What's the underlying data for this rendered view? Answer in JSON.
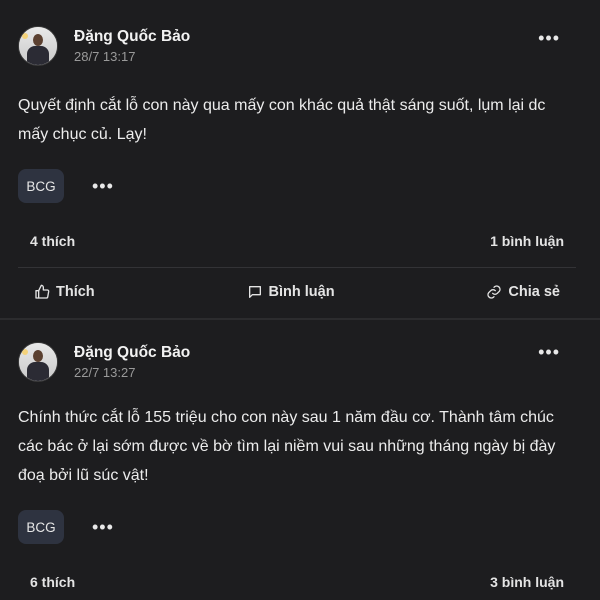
{
  "posts": [
    {
      "author": "Đặng Quốc Bảo",
      "time": "28/7 13:17",
      "content": "Quyết định cắt lỗ con này qua mấy con khác quả thật sáng suốt, lụm lại dc mấy chục củ. Lạy!",
      "tag": "BCG",
      "likes": "4 thích",
      "comments": "1 bình luận",
      "actions": {
        "like": "Thích",
        "comment": "Bình luận",
        "share": "Chia sẻ"
      }
    },
    {
      "author": "Đặng Quốc Bảo",
      "time": "22/7 13:27",
      "content": "Chính thức cắt lỗ 155 triệu cho con này sau 1 năm đầu cơ. Thành tâm chúc các bác ở lại sớm được về bờ tìm lại niềm vui sau những tháng ngày bị đày đoạ bởi lũ súc vật!",
      "tag": "BCG",
      "likes": "6 thích",
      "comments": "3 bình luận"
    }
  ],
  "icons": {
    "more": "more-horizontal-icon",
    "like": "thumbs-up-icon",
    "comment": "chat-bubble-icon",
    "share": "link-icon"
  }
}
